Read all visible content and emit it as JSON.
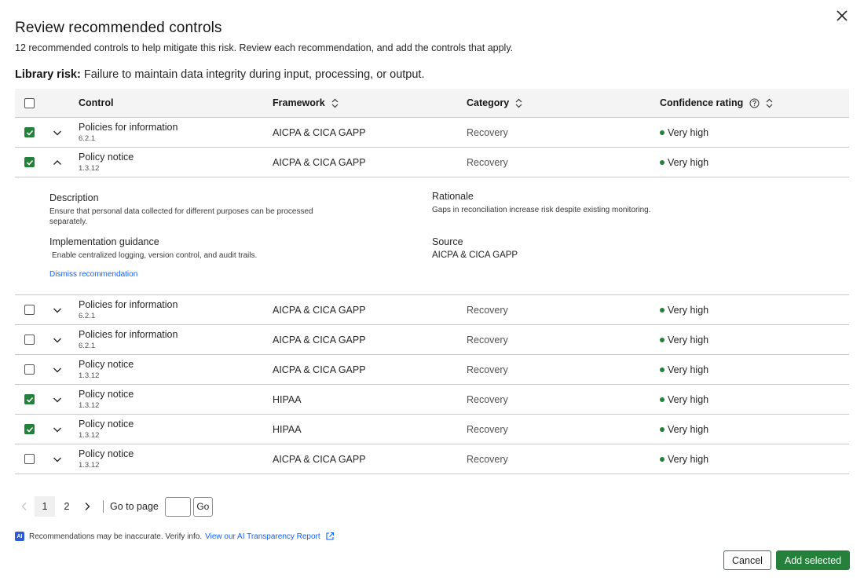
{
  "modal": {
    "title": "Review recommended controls",
    "subtitle": "12 recommended controls to help mitigate this risk. Review each recommendation, and add the controls that apply.",
    "risk_label": "Library risk:",
    "risk_text": "Failure to maintain data integrity during input, processing, or output."
  },
  "table": {
    "headers": {
      "control": "Control",
      "framework": "Framework",
      "category": "Category",
      "confidence": "Confidence rating"
    },
    "rows": [
      {
        "checked": true,
        "expanded": false,
        "name": "Policies for information",
        "code": "6.2.1",
        "framework": "AICPA & CICA GAPP",
        "category": "Recovery",
        "confidence": "Very high"
      },
      {
        "checked": true,
        "expanded": true,
        "name": "Policy notice",
        "code": "1.3.12",
        "framework": "AICPA & CICA GAPP",
        "category": "Recovery",
        "confidence": "Very high"
      },
      {
        "checked": false,
        "expanded": false,
        "name": "Policies for information",
        "code": "6.2.1",
        "framework": "AICPA & CICA GAPP",
        "category": "Recovery",
        "confidence": "Very high"
      },
      {
        "checked": false,
        "expanded": false,
        "name": "Policies for information",
        "code": "6.2.1",
        "framework": "AICPA & CICA GAPP",
        "category": "Recovery",
        "confidence": "Very high"
      },
      {
        "checked": false,
        "expanded": false,
        "name": "Policy notice",
        "code": "1.3.12",
        "framework": "AICPA & CICA GAPP",
        "category": "Recovery",
        "confidence": "Very high"
      },
      {
        "checked": true,
        "expanded": false,
        "name": "Policy notice",
        "code": "1.3.12",
        "framework": "HIPAA",
        "category": "Recovery",
        "confidence": "Very high"
      },
      {
        "checked": true,
        "expanded": false,
        "name": "Policy notice",
        "code": "1.3.12",
        "framework": "HIPAA",
        "category": "Recovery",
        "confidence": "Very high"
      },
      {
        "checked": false,
        "expanded": false,
        "name": "Policy notice",
        "code": "1.3.12",
        "framework": "AICPA & CICA GAPP",
        "category": "Recovery",
        "confidence": "Very high"
      }
    ],
    "details": {
      "description_label": "Description",
      "description_text": "Ensure that personal data collected for different purposes can be processed separately.",
      "rationale_label": "Rationale",
      "rationale_text": "Gaps in reconciliation increase risk despite existing monitoring.",
      "guidance_label": "Implementation guidance",
      "guidance_text": "Enable centralized logging, version control, and audit trails.",
      "source_label": "Source",
      "source_text": "AICPA & CICA GAPP",
      "dismiss_label": "Dismiss recommendation"
    }
  },
  "pagination": {
    "pages": [
      "1",
      "2"
    ],
    "current": "1",
    "goto_label": "Go to page",
    "go_label": "Go",
    "goto_value": ""
  },
  "ai_note": {
    "badge": "AI",
    "text": "Recommendations may be inaccurate. Verify info.",
    "link": "View our AI Transparency Report"
  },
  "footer": {
    "cancel_label": "Cancel",
    "add_label": "Add selected"
  },
  "colors": {
    "accent": "#24803a",
    "link": "#0f62fe",
    "confidence_dot": "#24803a",
    "header_bg": "#f4f4f4"
  },
  "icons": {
    "close": "close-icon",
    "sort": "sort-icon",
    "help": "help-icon",
    "chevron_down": "chevron-down-icon",
    "chevron_up": "chevron-up-icon",
    "external": "external-link-icon"
  }
}
